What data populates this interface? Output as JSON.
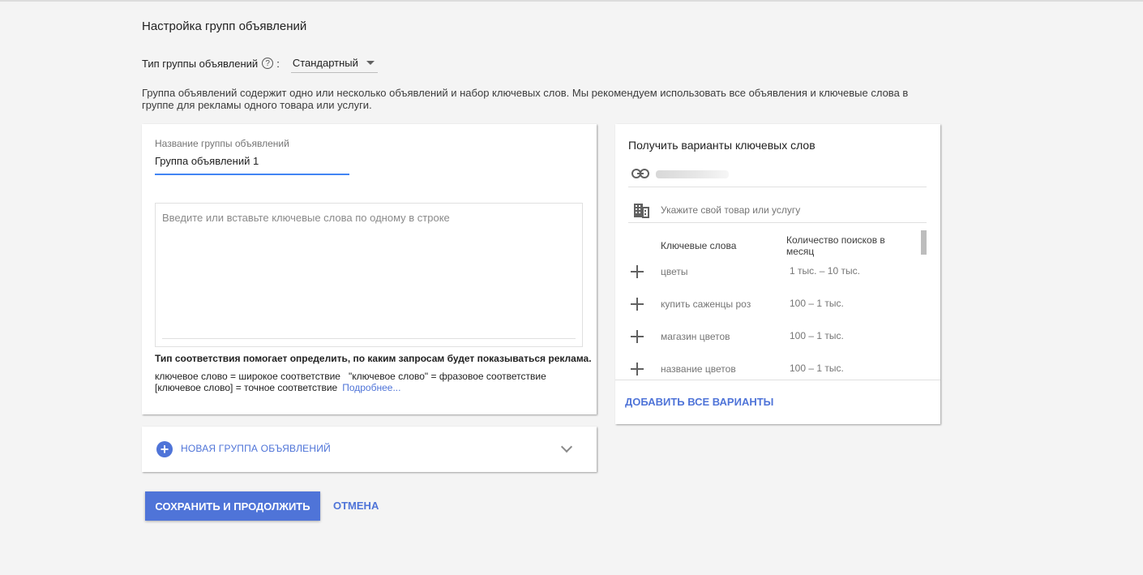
{
  "page": {
    "title": "Настройка групп объявлений"
  },
  "ad_group_type": {
    "label": "Тип группы объявлений",
    "colon": ":",
    "help_glyph": "?",
    "selected": "Стандартный"
  },
  "description": "Группа объявлений содержит одно или несколько объявлений и набор ключевых слов. Мы рекомендуем использовать все объявления и ключевые слова в группе для рекламы одного товара или услуги.",
  "ad_group": {
    "name_label": "Название группы объявлений",
    "name_value": "Группа объявлений 1",
    "keywords_placeholder": "Введите или вставьте ключевые слова по одному в строке",
    "match_title": "Тип соответствия помогает определить, по каким запросам будет показываться реклама.",
    "match_line1": "ключевое слово = широкое соответствие   \"ключевое слово\" = фразовое соответствие",
    "match_line2": "[ключевое слово] = точное соответствие",
    "more_link": "Подробнее..."
  },
  "new_group": {
    "plus_glyph": "+",
    "label": "НОВАЯ ГРУППА ОБЪЯВЛЕНИЙ"
  },
  "actions": {
    "save": "СОХРАНИТЬ И ПРОДОЛЖИТЬ",
    "cancel": "ОТМЕНА"
  },
  "keyword_ideas": {
    "title": "Получить варианты ключевых слов",
    "product_placeholder": "Укажите свой товар или услугу",
    "col_keywords": "Ключевые слова",
    "col_volume": "Количество поисков в месяц",
    "rows": [
      {
        "keyword": "цветы",
        "volume": "1 тыс. – 10 тыс."
      },
      {
        "keyword": "купить саженцы роз",
        "volume": "100 – 1 тыс."
      },
      {
        "keyword": "магазин цветов",
        "volume": "100 – 1 тыс."
      },
      {
        "keyword": "название цветов",
        "volume": "100 – 1 тыс."
      }
    ],
    "add_all": "ДОБАВИТЬ ВСЕ ВАРИАНТЫ"
  },
  "colors": {
    "accent": "#4f74d8",
    "focus_underline": "#4285f4",
    "background": "#f4f4f4"
  },
  "icons": {
    "help": "help-circle-icon",
    "dropdown": "caret-down-icon",
    "add_group": "plus-circle-icon",
    "expand": "chevron-down-icon",
    "link": "link-icon",
    "product": "building-icon",
    "add_keyword": "plus-icon"
  }
}
